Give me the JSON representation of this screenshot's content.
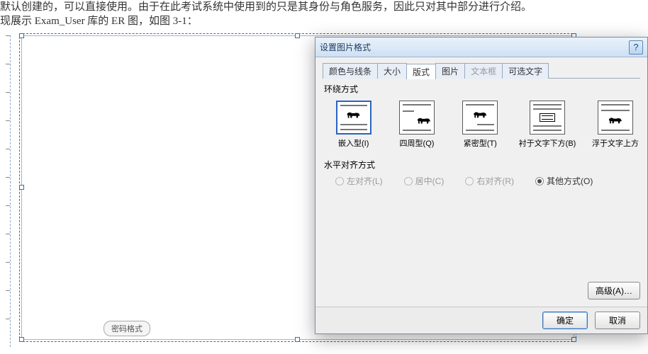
{
  "document": {
    "paragraph": "默认创建的，可以直接使用。由于在此考试系统中使用到的只是其身份与角色服务，因此只对其中部分进行介绍。现展示 Exam_User 库的 ER 图，如图 3-1：",
    "object_label": "密码格式"
  },
  "dialog": {
    "title": "设置图片格式",
    "help": "?",
    "tabs": {
      "colors_lines": "颜色与线条",
      "size": "大小",
      "layout": "版式",
      "picture": "图片",
      "textbox": "文本框",
      "alt_text": "可选文字"
    },
    "wrap": {
      "group": "环绕方式",
      "inline": "嵌入型(I)",
      "square": "四周型(Q)",
      "tight": "紧密型(T)",
      "behind": "衬于文字下方(B)",
      "front": "浮于文字上方"
    },
    "align": {
      "group": "水平对齐方式",
      "left": "左对齐(L)",
      "center": "居中(C)",
      "right": "右对齐(R)",
      "other": "其他方式(O)"
    },
    "buttons": {
      "advanced": "高级(A)…",
      "ok": "确定",
      "cancel": "取消"
    }
  }
}
